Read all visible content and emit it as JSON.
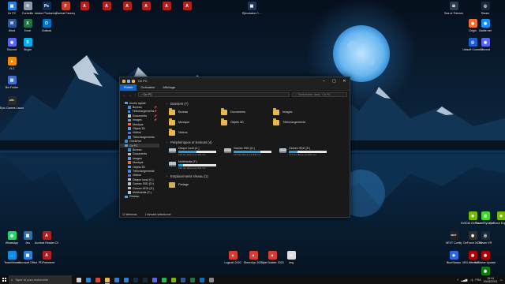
{
  "desktop_icons": [
    {
      "label": "Ce PC",
      "color": "#2b7fd6",
      "glyph": "▣"
    },
    {
      "label": "Corbeille",
      "color": "#8a9aa8",
      "glyph": "♲"
    },
    {
      "label": "Adobe Photoshop CC",
      "color": "#0f2e57",
      "glyph": "Ps"
    },
    {
      "label": "Format Factory",
      "color": "#c23d2b",
      "glyph": "F"
    },
    {
      "label": "",
      "color": "#b21f1f",
      "glyph": "A"
    },
    {
      "label": "",
      "color": "#b21f1f",
      "glyph": "A"
    },
    {
      "label": "",
      "color": "#b21f1f",
      "glyph": "A"
    },
    {
      "label": "",
      "color": "#b21f1f",
      "glyph": "A"
    },
    {
      "label": "",
      "color": "#b21f1f",
      "glyph": "A"
    },
    {
      "label": "",
      "color": "#b21f1f",
      "glyph": "A"
    },
    {
      "label": "Word",
      "color": "#2b579a",
      "glyph": "W"
    },
    {
      "label": "Excel",
      "color": "#217346",
      "glyph": "X"
    },
    {
      "label": "Outlook",
      "color": "#0072c6",
      "glyph": "O"
    },
    {
      "label": "Discord",
      "color": "#5865f2",
      "glyph": "◉"
    },
    {
      "label": "Skype",
      "color": "#00aff0",
      "glyph": "S"
    },
    {
      "label": "VLC",
      "color": "#f08c00",
      "glyph": "▲"
    },
    {
      "label": "Bin Folder",
      "color": "#3c6ccf",
      "glyph": "▤"
    },
    {
      "label": "Epic Games Launcher",
      "color": "#2a2a2a",
      "glyph": "EPIC"
    },
    {
      "label": "Ejecutador C...",
      "color": "#1f3553",
      "glyph": "▣"
    },
    {
      "label": "Sea of Thieves",
      "color": "#2c3e50",
      "glyph": "☠"
    },
    {
      "label": "Steam",
      "color": "#1b2838",
      "glyph": "◎"
    },
    {
      "label": "Battle.net",
      "color": "#148eff",
      "glyph": "◉"
    },
    {
      "label": "Origin",
      "color": "#f56c2d",
      "glyph": "◉"
    },
    {
      "label": "Ubisoft Connect",
      "color": "#1f5bd6",
      "glyph": "◎"
    },
    {
      "label": "Discord",
      "color": "#5865f2",
      "glyph": "◉"
    },
    {
      "label": "WhatsApp",
      "color": "#25d366",
      "glyph": "◉"
    },
    {
      "label": "Jeu",
      "color": "#2f6fa8",
      "glyph": "▦"
    },
    {
      "label": "PDFelement",
      "color": "#b21f1f",
      "glyph": "A"
    },
    {
      "label": "TeamViewer",
      "color": "#0e8ee9",
      "glyph": "↔"
    },
    {
      "label": "Microsoft Office",
      "color": "#2b7fd6",
      "glyph": "▦"
    },
    {
      "label": "Acrobat Reader DC",
      "color": "#b21f1f",
      "glyph": "A"
    },
    {
      "label": "Logiciel 2020",
      "color": "#d83b32",
      "glyph": "▲"
    },
    {
      "label": "SketchUp 2020",
      "color": "#d83b32",
      "glyph": "▲"
    },
    {
      "label": "Style Builder 2020",
      "color": "#d83b32",
      "glyph": "▲"
    },
    {
      "label": ".img",
      "color": "#dcdcdc",
      "glyph": "▭"
    },
    {
      "label": "NVIDIA GeForce Experience",
      "color": "#76b900",
      "glyph": "◆"
    },
    {
      "label": "Razer Synapse",
      "color": "#44d62c",
      "glyph": "◎"
    },
    {
      "label": "GeForce NOW",
      "color": "#2f2f2f",
      "glyph": "◉"
    },
    {
      "label": "Steam VR",
      "color": "#1b2838",
      "glyph": "◎"
    },
    {
      "label": "NEXT Config",
      "color": "#222",
      "glyph": "NEXT"
    },
    {
      "label": "MSI Afterburner",
      "color": "#b10000",
      "glyph": "◉"
    },
    {
      "label": "MSI Live Update",
      "color": "#b10000",
      "glyph": "◉"
    },
    {
      "label": "BlueStacks",
      "color": "#2a6ae0",
      "glyph": "◆"
    },
    {
      "label": "Xbox Console",
      "color": "#107c10",
      "glyph": "◉"
    },
    {
      "label": "GeForce Experience",
      "color": "#76b900",
      "glyph": "◆"
    }
  ],
  "explorer": {
    "title": "Ce PC",
    "tabs": [
      "Fichier",
      "Ordinateur",
      "Affichage"
    ],
    "address": "›  Ce PC",
    "search_placeholder": "Rechercher dans : Ce PC",
    "nav_back": "←",
    "nav_forward": "→",
    "nav_up": "↑",
    "navpane": [
      {
        "label": "Accès rapide",
        "color": "#5aa0e8",
        "sub": false,
        "pin": false
      },
      {
        "label": "Bureau",
        "color": "#3f8fd8",
        "sub": true,
        "pin": true
      },
      {
        "label": "Téléchargements",
        "color": "#3f8fd8",
        "sub": true,
        "pin": true
      },
      {
        "label": "Documents",
        "color": "#b9c3cc",
        "sub": true,
        "pin": true
      },
      {
        "label": "Images",
        "color": "#5aa0e8",
        "sub": true,
        "pin": true
      },
      {
        "label": "Musique",
        "color": "#e86f3c",
        "sub": true,
        "pin": false
      },
      {
        "label": "Objets 3D",
        "color": "#5aa0e8",
        "sub": true,
        "pin": false
      },
      {
        "label": "Vidéos",
        "color": "#7a5bd6",
        "sub": true,
        "pin": false
      },
      {
        "label": "Téléchargements",
        "color": "#3f8fd8",
        "sub": true,
        "pin": false
      },
      {
        "label": "OneDrive",
        "color": "#3a8ae0",
        "sub": false,
        "pin": false
      },
      {
        "label": "Ce PC",
        "color": "#4fa3e6",
        "sub": false,
        "pin": false,
        "sel": true
      },
      {
        "label": "Bureau",
        "color": "#3f8fd8",
        "sub": true,
        "pin": false
      },
      {
        "label": "Documents",
        "color": "#b9c3cc",
        "sub": true,
        "pin": false
      },
      {
        "label": "Images",
        "color": "#5aa0e8",
        "sub": true,
        "pin": false
      },
      {
        "label": "Musique",
        "color": "#e86f3c",
        "sub": true,
        "pin": false
      },
      {
        "label": "Objets 3D",
        "color": "#5aa0e8",
        "sub": true,
        "pin": false
      },
      {
        "label": "Téléchargements",
        "color": "#3f8fd8",
        "sub": true,
        "pin": false
      },
      {
        "label": "Vidéos",
        "color": "#7a5bd6",
        "sub": true,
        "pin": false
      },
      {
        "label": "Disque local (C:)",
        "color": "#b9c3cc",
        "sub": true,
        "pin": false
      },
      {
        "label": "Games SSD (D:)",
        "color": "#b9c3cc",
        "sub": true,
        "pin": false
      },
      {
        "label": "Games HDD (E:)",
        "color": "#b9c3cc",
        "sub": true,
        "pin": false
      },
      {
        "label": "Multimédia (F:)",
        "color": "#b9c3cc",
        "sub": true,
        "pin": false
      },
      {
        "label": "Réseau",
        "color": "#5aa0e8",
        "sub": false,
        "pin": false
      }
    ],
    "folders_header": "Dossiers (7)",
    "folders": [
      "Bureau",
      "Documents",
      "Images",
      "Musique",
      "Objets 3D",
      "Téléchargements",
      "Vidéos"
    ],
    "drives_header": "Périphériques et lecteurs (4)",
    "drives": [
      {
        "name": "Disque local (C:)",
        "free": "115 Go libres sur 223 Go",
        "used_fraction": 0.48
      },
      {
        "name": "Games SSD (D:)",
        "free": "273 Go libres sur 931 Go",
        "used_fraction": 0.71
      },
      {
        "name": "Games HDD (E:)",
        "free": "717 Go libres sur 931 Go",
        "used_fraction": 0.23
      },
      {
        "name": "Multimédia (F:)",
        "free": "815 Go libres sur 931 Go",
        "used_fraction": 0.12
      }
    ],
    "network_header": "Emplacements réseau (1)",
    "network": [
      "Partage"
    ],
    "status_count": "12 éléments",
    "status_selected": "1 élément sélectionné"
  },
  "taskbar": {
    "search_placeholder": "Taper ici pour rechercher",
    "apps": [
      {
        "name": "task-view",
        "color": "#cfcfcf",
        "active": false
      },
      {
        "name": "edge",
        "color": "#1e88e5",
        "active": false
      },
      {
        "name": "chrome",
        "color": "#e34133",
        "active": false
      },
      {
        "name": "file-explorer",
        "color": "#e8b94a",
        "active": true
      },
      {
        "name": "store",
        "color": "#2b7fd6",
        "active": false
      },
      {
        "name": "mail",
        "color": "#2b7fd6",
        "active": false
      },
      {
        "name": "photoshop",
        "color": "#0f2e57",
        "active": false
      },
      {
        "name": "steam",
        "color": "#1b2838",
        "active": false
      },
      {
        "name": "discord",
        "color": "#5865f2",
        "active": false
      },
      {
        "name": "spotify",
        "color": "#1db954",
        "active": false
      },
      {
        "name": "nvidia",
        "color": "#76b900",
        "active": false
      },
      {
        "name": "word",
        "color": "#2b579a",
        "active": false
      },
      {
        "name": "excel",
        "color": "#217346",
        "active": false
      },
      {
        "name": "outlook",
        "color": "#0072c6",
        "active": false
      },
      {
        "name": "settings",
        "color": "#888888",
        "active": false
      }
    ],
    "time": "15:24",
    "date": "20/05/2021",
    "lang": "FRA"
  }
}
